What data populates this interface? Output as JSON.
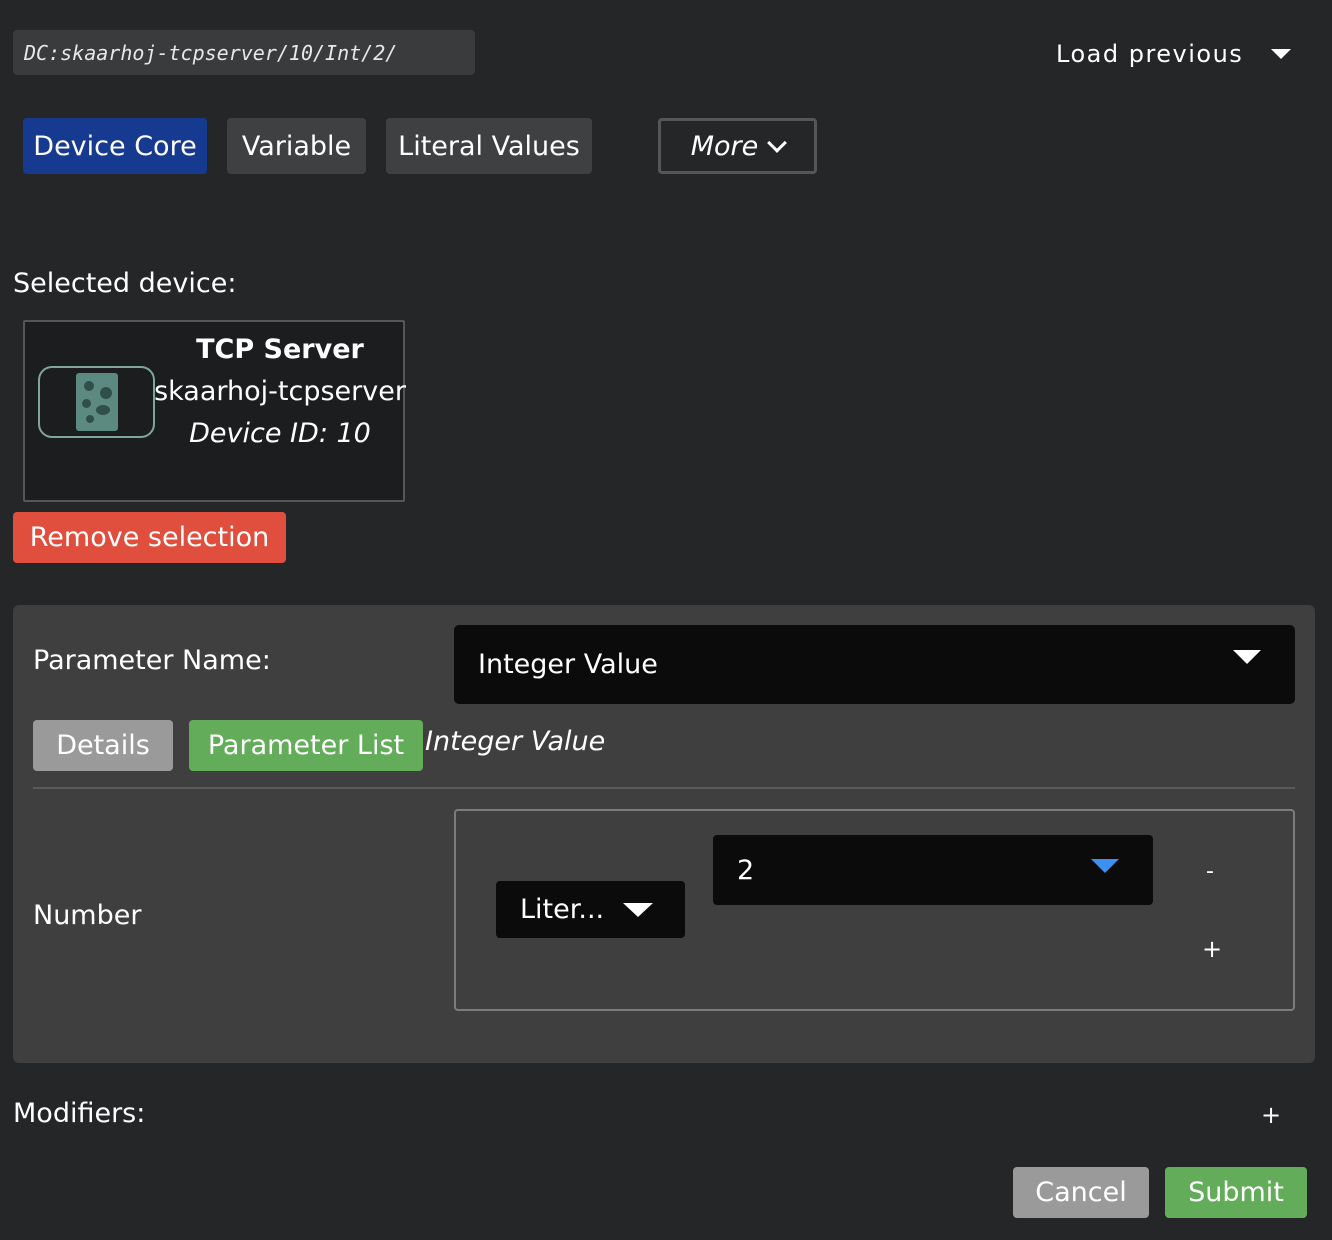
{
  "path": "DC:skaarhoj-tcpserver/10/Int/2/",
  "load_previous": "Load previous",
  "tabs": {
    "device_core": "Device Core",
    "variable": "Variable",
    "literal_values": "Literal Values",
    "more": "More"
  },
  "selected_device": {
    "label": "Selected device:",
    "name": "TCP Server",
    "identifier": "skaarhoj-tcpserver",
    "device_id": "Device ID: 10",
    "remove_label": "Remove selection"
  },
  "parameter": {
    "name_label": "Parameter Name:",
    "selected": "Integer Value",
    "details_label": "Details",
    "param_list_label": "Parameter List",
    "current": "Integer Value"
  },
  "number": {
    "label": "Number",
    "type": "Liter...",
    "value": "2",
    "minus": "-",
    "plus": "+"
  },
  "modifiers": {
    "label": "Modifiers:",
    "add": "+"
  },
  "footer": {
    "cancel": "Cancel",
    "submit": "Submit"
  },
  "colors": {
    "background": "#252628",
    "tab_active": "#173a91",
    "danger": "#e04f3d",
    "success": "#63ad5a",
    "dropdown_accent": "#3d8ff2"
  }
}
